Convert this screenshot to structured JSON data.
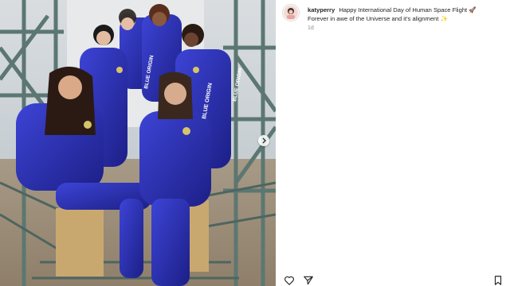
{
  "post": {
    "username": "katyperry",
    "caption_line1": "Happy International Day of Human Space Flight",
    "caption_emoji1": "🚀",
    "caption_line2": "Forever in awe of the Universe and it's alignment",
    "caption_emoji2": "✨",
    "time_ago": "1d"
  },
  "photo": {
    "suit_text": "BLUE ORIGIN",
    "suit_color": "#2a2fb3",
    "sky_color": "#c9d0d6",
    "tower_color": "#6f8a84"
  },
  "icons": {
    "like": "heart-icon",
    "share": "paper-plane-icon",
    "save": "bookmark-icon",
    "next": "chevron-right-icon"
  },
  "colors": {
    "text": "#262626",
    "muted": "#8e8e8e",
    "border": "#dbdbdb"
  }
}
